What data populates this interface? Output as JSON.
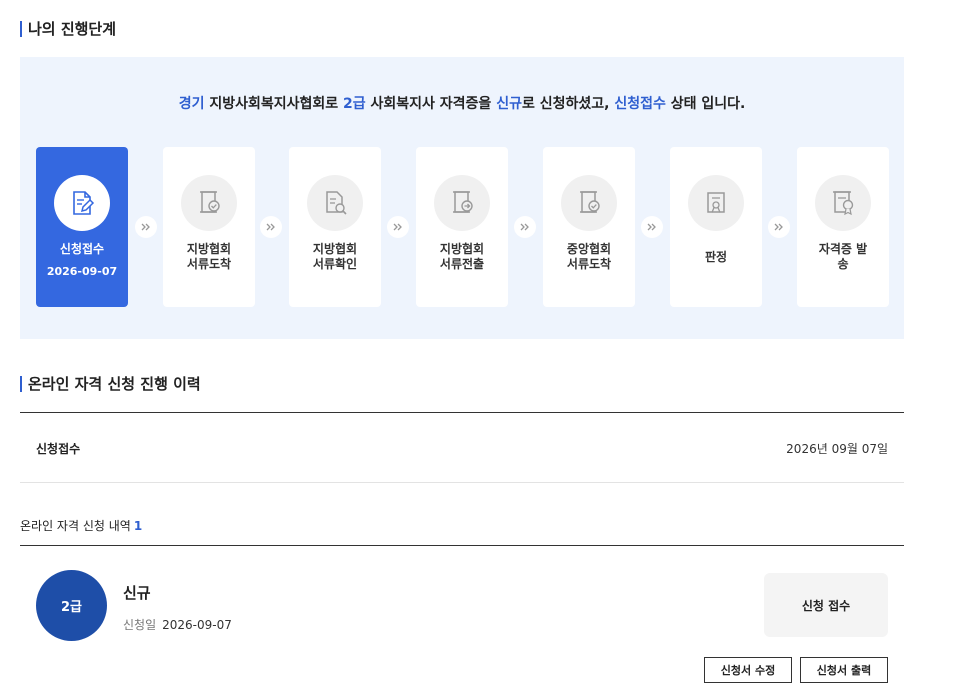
{
  "progress": {
    "title": "나의 진행단계",
    "sentence": {
      "region": "경기",
      "t1": " 지방사회복지사협회로 ",
      "grade": "2급",
      "t2": " 사회복지사 자격증을 ",
      "apply_type": "신규",
      "t3": "로 신청하셨고, ",
      "state": "신청접수",
      "t4": " 상태 입니다."
    },
    "steps": [
      {
        "label": "신청접수",
        "date": "2026-09-07",
        "icon": "document-edit-icon",
        "active": true
      },
      {
        "label": "지방협회\n서류도착",
        "icon": "document-check-icon",
        "active": false
      },
      {
        "label": "지방협회\n서류확인",
        "icon": "document-search-icon",
        "active": false
      },
      {
        "label": "지방협회\n서류전출",
        "icon": "document-send-icon",
        "active": false
      },
      {
        "label": "중앙협회\n서류도착",
        "icon": "document-check-icon",
        "active": false
      },
      {
        "label": "판정",
        "icon": "certificate-icon",
        "active": false
      },
      {
        "label": "자격증 발\n송",
        "icon": "certificate-ship-icon",
        "active": false
      }
    ],
    "colors": {
      "accent": "#3468e0",
      "highlight": "#2f5fd0",
      "panel": "#eef4fd"
    }
  },
  "history": {
    "title": "온라인 자격 신청 진행 이력",
    "rows": [
      {
        "status": "신청접수",
        "date": "2026년 09월 07일"
      }
    ]
  },
  "applications": {
    "title": "온라인 자격 신청 내역",
    "count": "1",
    "items": [
      {
        "grade": "2급",
        "type": "신규",
        "date_label": "신청일",
        "date": "2026-09-07",
        "status": "신청 접수",
        "edit_label": "신청서 수정",
        "print_label": "신청서 출력"
      }
    ]
  }
}
